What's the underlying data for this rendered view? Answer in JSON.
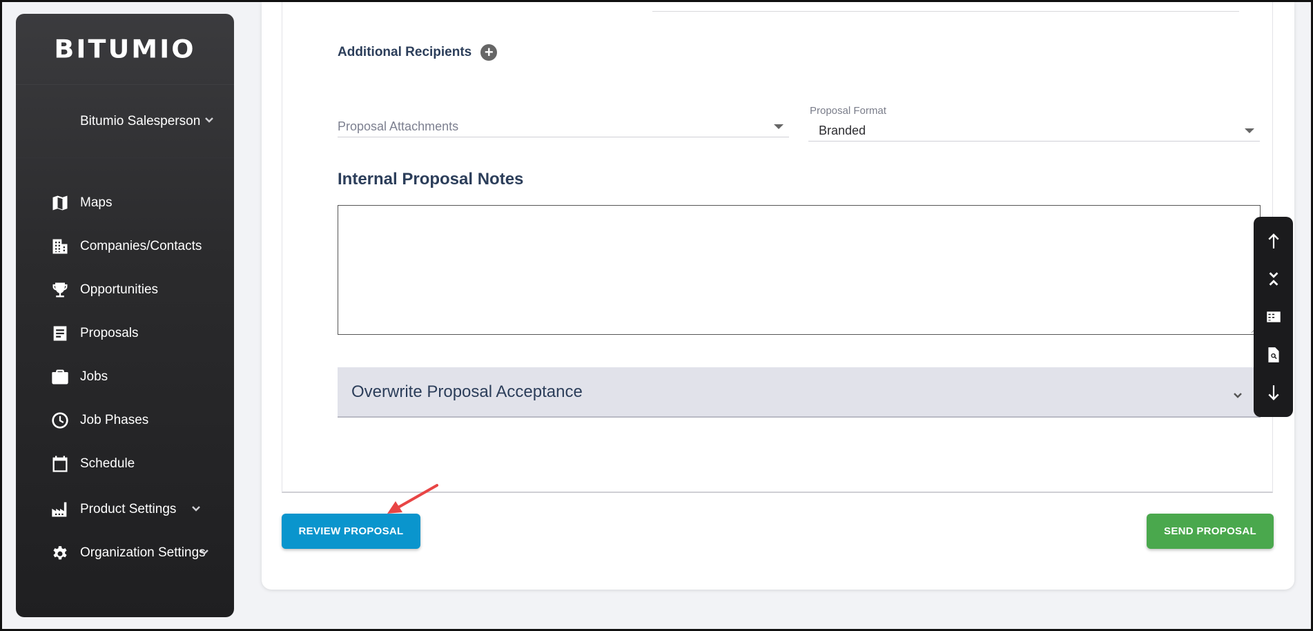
{
  "sidebar": {
    "logo": "BITUMIO",
    "user_name": "Bitumio Salesperson",
    "items": [
      {
        "label": "Maps",
        "icon": "map-icon"
      },
      {
        "label": "Companies/Contacts",
        "icon": "building-icon"
      },
      {
        "label": "Opportunities",
        "icon": "trophy-icon"
      },
      {
        "label": "Proposals",
        "icon": "document-icon"
      },
      {
        "label": "Jobs",
        "icon": "briefcase-icon"
      },
      {
        "label": "Job Phases",
        "icon": "clock-icon"
      },
      {
        "label": "Schedule",
        "icon": "calendar-icon"
      },
      {
        "label": "Product Settings",
        "icon": "factory-icon"
      },
      {
        "label": "Organization Settings",
        "icon": "gear-icon"
      }
    ]
  },
  "form": {
    "additional_recipients_label": "Additional Recipients",
    "attachments_placeholder": "Proposal Attachments",
    "format_label": "Proposal Format",
    "format_value": "Branded",
    "notes_title": "Internal Proposal Notes",
    "notes_value": "",
    "accordion_label": "Overwrite Proposal Acceptance"
  },
  "actions": {
    "review_label": "REVIEW PROPOSAL",
    "send_label": "SEND PROPOSAL"
  },
  "toolbar": {
    "icons": [
      "arrow-up-icon",
      "collapse-icon",
      "checklist-icon",
      "file-search-icon",
      "arrow-down-icon"
    ]
  },
  "colors": {
    "review_button": "#0a95cd",
    "send_button": "#4aa84d",
    "heading": "#2c3e5a",
    "annotation_arrow": "#e84545"
  }
}
